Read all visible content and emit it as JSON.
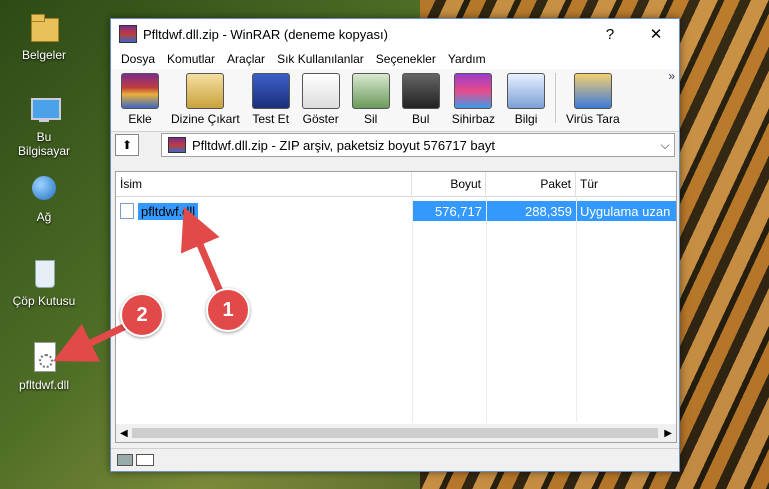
{
  "desktop": {
    "icons": [
      {
        "label": "Belgeler",
        "icon": "folder-icon"
      },
      {
        "label": "Bu Bilgisayar",
        "icon": "computer-icon"
      },
      {
        "label": "Ağ",
        "icon": "network-icon"
      },
      {
        "label": "Çöp Kutusu",
        "icon": "recycle-bin-icon"
      },
      {
        "label": "pfltdwf.dll",
        "icon": "dll-file-icon"
      }
    ]
  },
  "window": {
    "title": "Pfltdwf.dll.zip - WinRAR (deneme kopyası)",
    "help_btn": "?",
    "close_btn": "✕"
  },
  "menu": [
    "Dosya",
    "Komutlar",
    "Araçlar",
    "Sık Kullanılanlar",
    "Seçenekler",
    "Yardım"
  ],
  "toolbar": {
    "items": [
      "Ekle",
      "Dizine Çıkart",
      "Test Et",
      "Göster",
      "Sil",
      "Bul",
      "Sihirbaz",
      "Bilgi",
      "Virüs Tara"
    ],
    "more": "»"
  },
  "address": {
    "up_glyph": "⬆",
    "text": "Pfltdwf.dll.zip - ZIP arşiv, paketsiz boyut 576717 bayt",
    "dropdown": "⌵"
  },
  "list": {
    "columns": [
      "İsim",
      "Boyut",
      "Paket",
      "Tür"
    ],
    "rows": [
      {
        "name": "pfltdwf.dll",
        "size": "576,717",
        "packed": "288,359",
        "type": "Uygulama uzan"
      }
    ]
  },
  "annotations": {
    "badge1": "1",
    "badge2": "2"
  },
  "colors": {
    "selection": "#3399ff",
    "badge": "#e24a4a"
  }
}
